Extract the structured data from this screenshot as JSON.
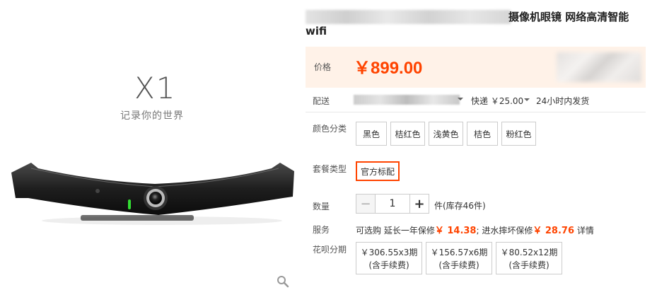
{
  "image": {
    "logo_text": "X1",
    "slogan": "记录你的世界"
  },
  "title": {
    "line1_tail": "摄像机眼镜 网络高清智能",
    "line2": "wifi"
  },
  "price": {
    "label": "价格",
    "value": "￥899.00"
  },
  "shipping": {
    "label": "配送",
    "fee": "快递 ￥25.00",
    "time": "24小时内发货"
  },
  "color": {
    "label": "颜色分类",
    "options": [
      "黑色",
      "桔红色",
      "浅黄色",
      "桔色",
      "粉红色"
    ]
  },
  "package": {
    "label": "套餐类型",
    "options": [
      "官方标配"
    ],
    "selected": "官方标配"
  },
  "quantity": {
    "label": "数量",
    "minus": "−",
    "value": "1",
    "plus": "+",
    "stock": "件(库存46件)"
  },
  "service": {
    "label": "服务",
    "prefix": "可选购 延长一年保修",
    "price1": "￥ 14.38",
    "mid": "; 进水摔坏保修",
    "price2": "￥ 28.76",
    "detail": " 详情"
  },
  "installment": {
    "label": "花呗分期",
    "options": [
      {
        "amount": "￥306.55x3期",
        "fee": "(含手续费)"
      },
      {
        "amount": "￥156.57x6期",
        "fee": "(含手续费)"
      },
      {
        "amount": "￥80.52x12期",
        "fee": "(含手续费)"
      }
    ]
  },
  "colors": {
    "accent": "#ff4400",
    "price_bg": "#fff2e8",
    "border": "#cccccc"
  },
  "icons": {
    "zoom": "magnifier-icon"
  }
}
